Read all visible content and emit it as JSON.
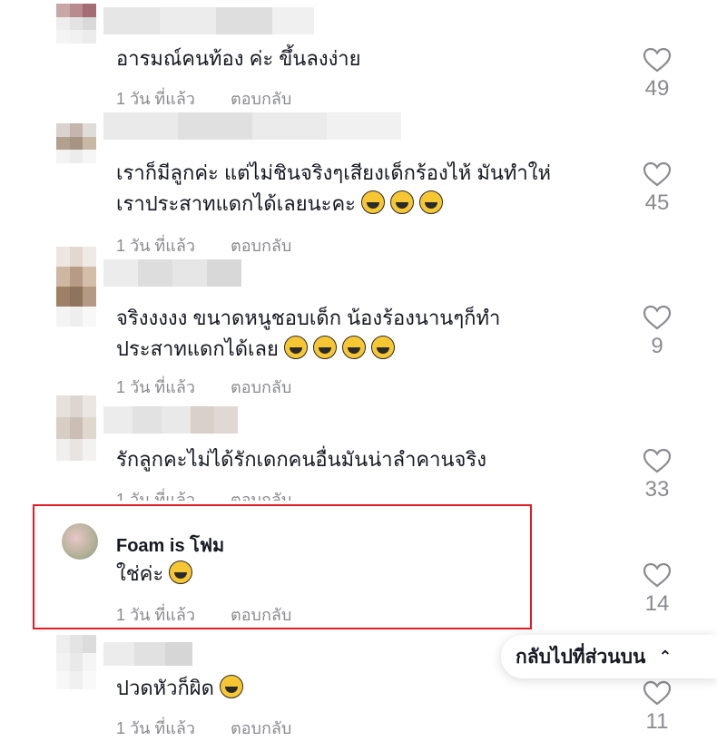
{
  "comments": [
    {
      "text": "อารมณ์คนท้อง ค่ะ ขึ้นลงง่าย",
      "time": "1 วัน ที่แล้ว",
      "reply": "ตอบกลับ",
      "likes": "49"
    },
    {
      "text": "เราก็มีลูกค่ะ แต่ไม่ชินจริงๆเสียงเด็กร้องไห้ มันทำให่\nเราประสาทแดกได้เลยนะคะ",
      "time": "1 วัน ที่แล้ว",
      "reply": "ตอบกลับ",
      "likes": "45"
    },
    {
      "text": "จริงงงงง ขนาดหนูชอบเด็ก น้องร้องนานๆก็ทำ\nประสาทแดกได้เลย",
      "time": "1 วัน ที่แล้ว",
      "reply": "ตอบกลับ",
      "likes": "9"
    },
    {
      "text": "รักลูกคะไม่ได้รักเดกคนอื่นมันน่าลำคานจริง",
      "time": "1 วัน ที่แล้ว",
      "reply": "ตอบกลับ",
      "likes": "33"
    },
    {
      "name": "Foam is โฟม",
      "text": "ใช่ค่ะ",
      "time": "1 วัน ที่แล้ว",
      "reply": "ตอบกลับ",
      "likes": "14"
    },
    {
      "text": "ปวดหัวก็ผิด",
      "time": "1 วัน ที่แล้ว",
      "reply": "ตอบกลับ",
      "likes": "11"
    }
  ],
  "back_to_top": {
    "label": "กลับไปที่ส่วนบน",
    "icon": "double-chevron-up-icon"
  },
  "colors": {
    "highlight": "#e11d23",
    "muted": "#8a8b91",
    "emoji": "#f7c633"
  }
}
